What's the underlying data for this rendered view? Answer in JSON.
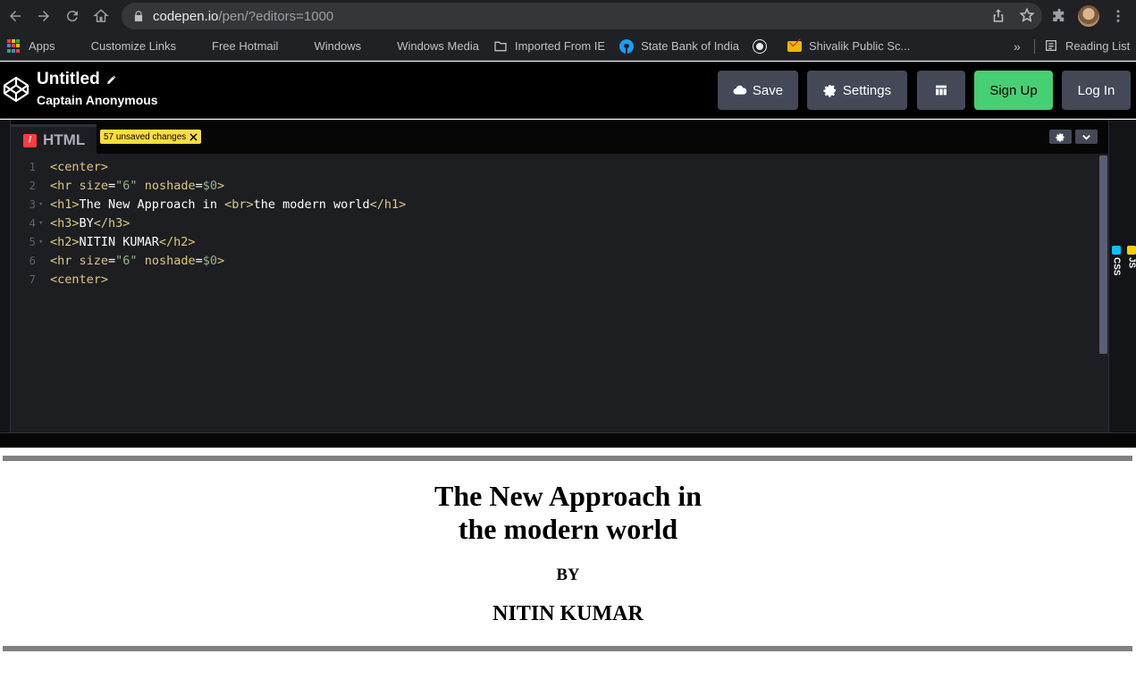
{
  "browser": {
    "url_host": "codepen.io",
    "url_path": "/pen/?editors=1000"
  },
  "bookmarks": {
    "items": [
      {
        "label": "Apps",
        "icon": "apps-grid-icon"
      },
      {
        "label": "Customize Links",
        "icon": "windows-logo-icon"
      },
      {
        "label": "Free Hotmail",
        "icon": "windows-logo-icon"
      },
      {
        "label": "Windows",
        "icon": "windows-logo-icon"
      },
      {
        "label": "Windows Media",
        "icon": "windows-logo-icon"
      },
      {
        "label": "Imported From IE",
        "icon": "folder-icon"
      },
      {
        "label": "State Bank of India",
        "icon": "sbi-logo-icon"
      },
      {
        "label": "",
        "icon": "globe-icon"
      },
      {
        "label": "Shivalik Public Sc...",
        "icon": "mail-icon"
      }
    ],
    "more": "»",
    "reading_list": "Reading List"
  },
  "header": {
    "title": "Untitled",
    "author": "Captain Anonymous",
    "save": "Save",
    "settings": "Settings",
    "signup": "Sign Up",
    "login": "Log In"
  },
  "editor": {
    "tab_label": "HTML",
    "tab_badge": "/",
    "unsaved": "57 unsaved changes",
    "line_numbers": [
      "1",
      "2",
      "3",
      "4",
      "5",
      "6",
      "7"
    ],
    "side_tabs": {
      "css": "CSS",
      "js": "JS"
    }
  },
  "preview": {
    "h1_line1": "The New Approach in",
    "h1_line2": "the modern world",
    "h3": "BY",
    "h2": "NITIN KUMAR"
  },
  "colors": {
    "accent_green": "#47cf73",
    "html_red": "#ff3c41",
    "unsaved_yellow": "#ffdd40"
  }
}
